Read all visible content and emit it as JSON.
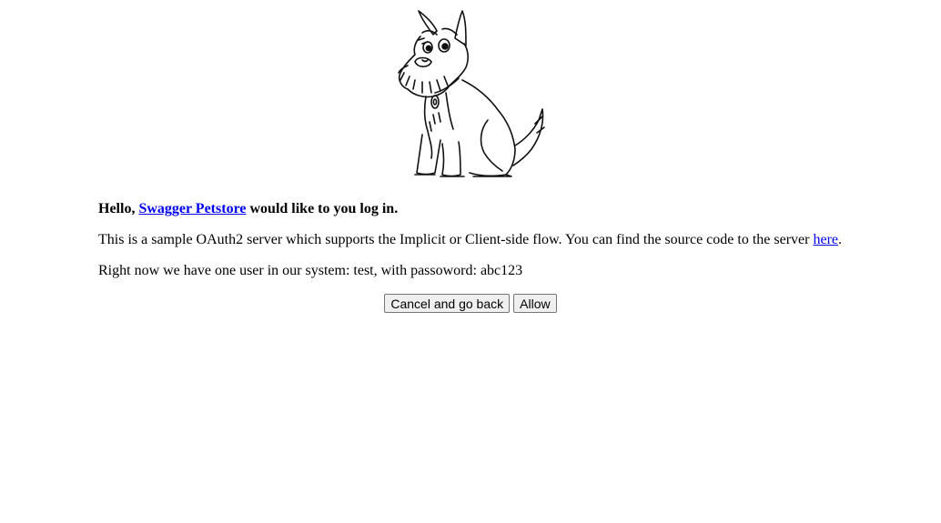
{
  "logo": {
    "icon": "scottish-terrier-dog-illustration"
  },
  "greeting": {
    "hello": "Hello, ",
    "app_name": "Swagger Petstore",
    "suffix": " would like to you log in."
  },
  "description": {
    "text": "This is a sample OAuth2 server which supports the Implicit or Client-side flow. You can find the source code to the server ",
    "link_label": "here",
    "suffix": "."
  },
  "user_info": "Right now we have one user in our system: test, with passoword: abc123",
  "actions": {
    "cancel_label": "Cancel and go back",
    "allow_label": "Allow"
  },
  "colors": {
    "link": "#0000ee",
    "button_bg": "#efefef",
    "button_border": "#767676"
  }
}
